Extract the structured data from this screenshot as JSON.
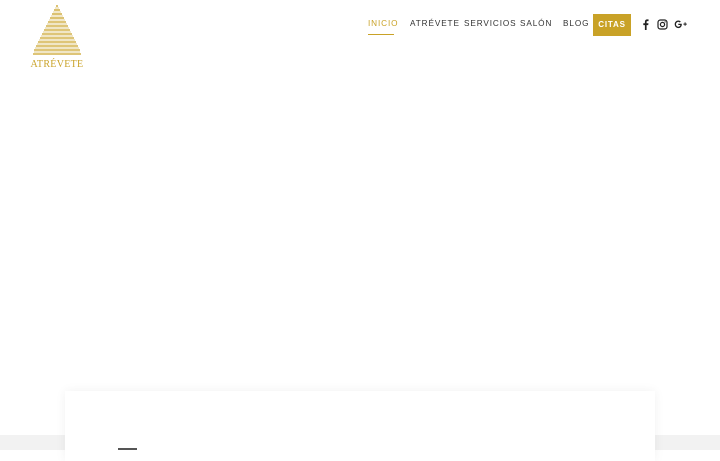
{
  "brand": {
    "name": "ATRÉVETE",
    "color": "#c9a227"
  },
  "nav": {
    "items": [
      {
        "label": "INICIO",
        "active": true
      },
      {
        "label": "ATRÉVETE"
      },
      {
        "label": "SERVICIOS"
      },
      {
        "label": "SALÓN"
      },
      {
        "label": "BLOG"
      }
    ],
    "cta_label": "CITAS"
  },
  "social": [
    {
      "icon": "facebook-icon"
    },
    {
      "icon": "instagram-icon"
    },
    {
      "icon": "google-plus-icon"
    }
  ],
  "colors": {
    "accent": "#c9a227",
    "text": "#333333",
    "band": "#f2f2f2"
  }
}
